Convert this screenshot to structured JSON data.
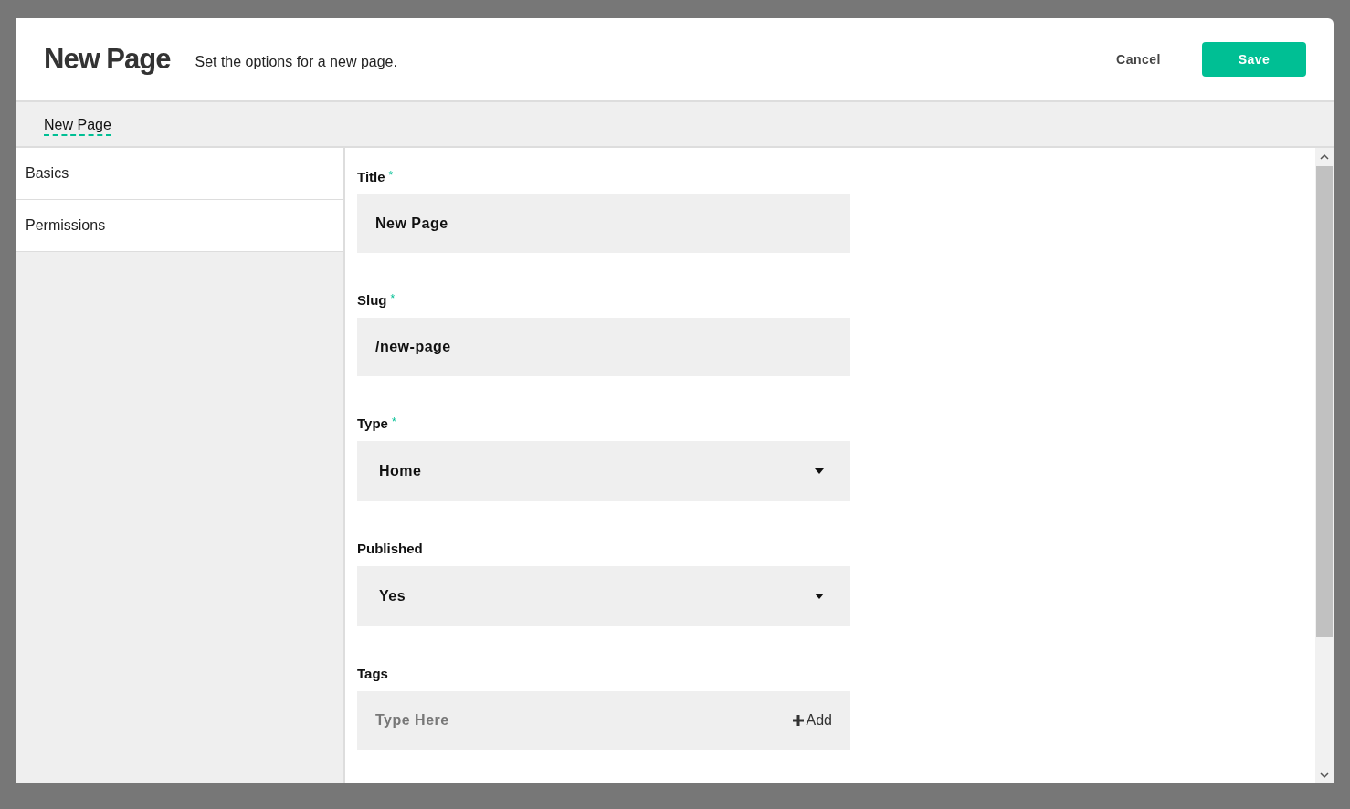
{
  "header": {
    "title": "New Page",
    "subtitle": "Set the options for a new page.",
    "cancel": "Cancel",
    "save": "Save"
  },
  "breadcrumb": {
    "label": "New Page"
  },
  "sidebar": {
    "items": [
      {
        "label": "Basics"
      },
      {
        "label": "Permissions"
      }
    ]
  },
  "fields": [
    {
      "kind": "text",
      "label": "Title",
      "marker": "*",
      "value": "New Page"
    },
    {
      "kind": "text",
      "label": "Slug",
      "marker": "*",
      "value": "/new-page"
    },
    {
      "kind": "select",
      "label": "Type",
      "marker": "*",
      "value": "Home"
    },
    {
      "kind": "select",
      "label": "Published",
      "value": "Yes"
    },
    {
      "kind": "tags",
      "label": "Tags",
      "placeholder": "Type Here",
      "action": "Add"
    }
  ]
}
